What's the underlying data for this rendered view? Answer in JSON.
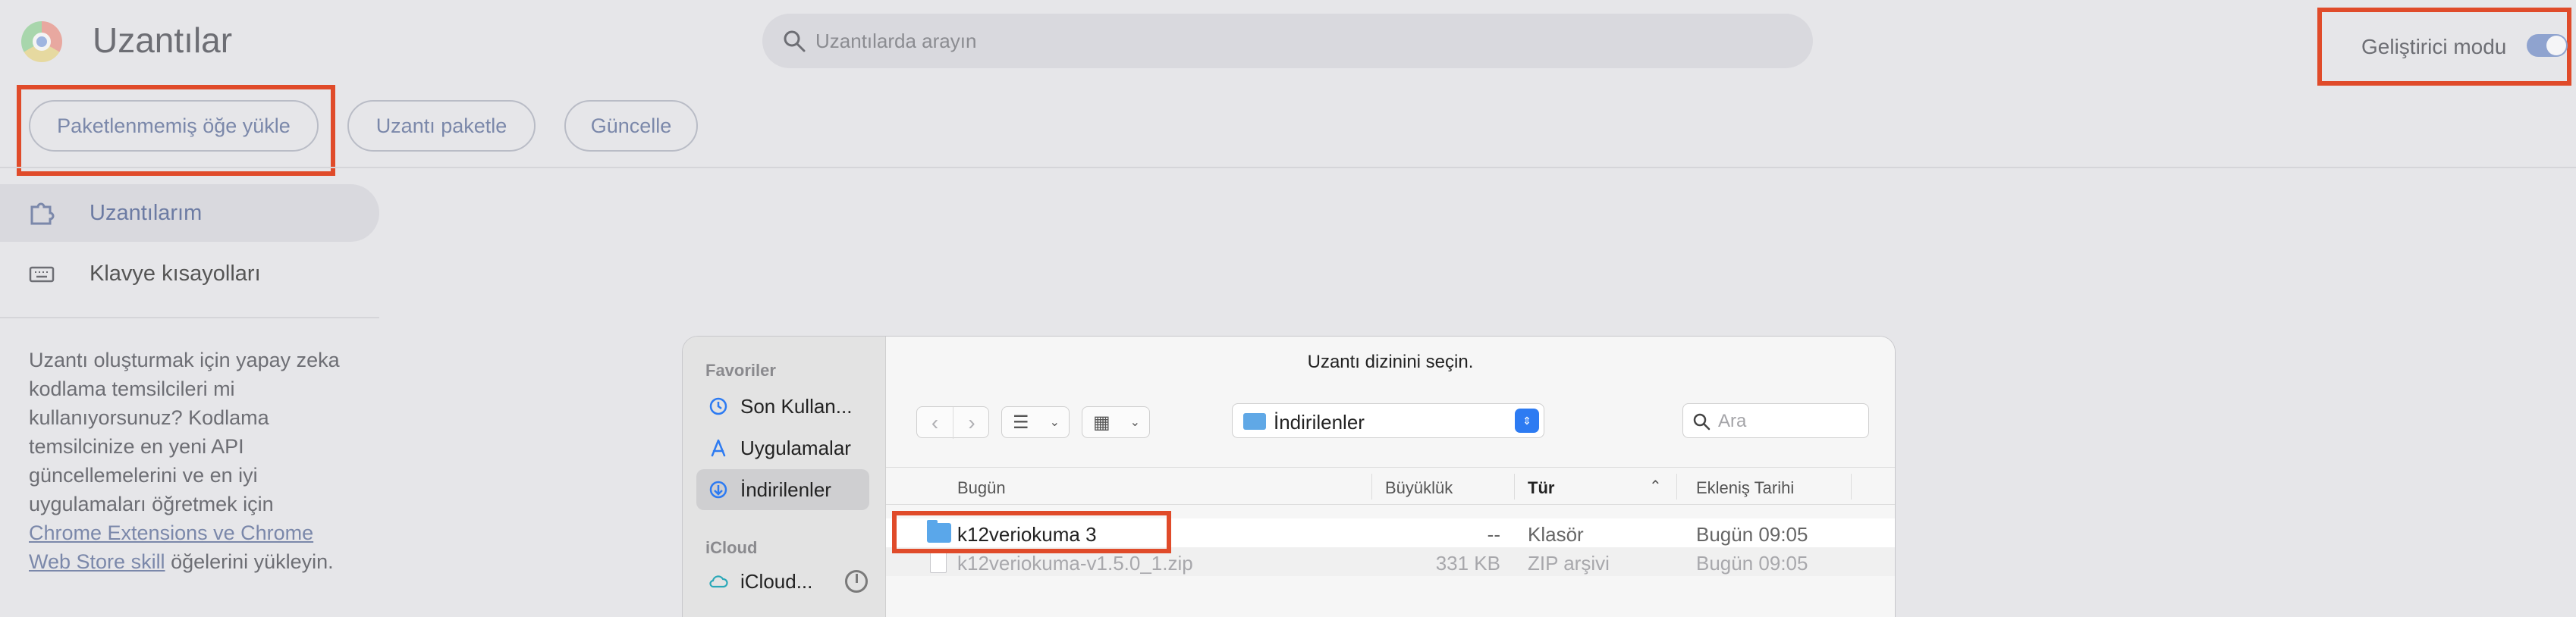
{
  "header": {
    "title": "Uzantılar",
    "search_placeholder": "Uzantılarda arayın",
    "dev_mode_label": "Geliştirici modu",
    "dev_mode_on": true
  },
  "toolbar": {
    "load_unpacked": "Paketlenmemiş öğe yükle",
    "pack_extension": "Uzantı paketle",
    "update": "Güncelle"
  },
  "sidebar": {
    "items": [
      {
        "label": "Uzantılarım",
        "icon": "puzzle-icon",
        "active": true
      },
      {
        "label": "Klavye kısayolları",
        "icon": "keyboard-icon",
        "active": false
      }
    ],
    "promo_text": "Uzantı oluşturmak için yapay zeka kodlama temsilcileri mi kullanıyorsunuz? Kodlama temsilcinize en yeni API güncellemelerini ve en iyi uygulamaları öğretmek için ",
    "promo_link": "Chrome Extensions ve Chrome Web Store skill",
    "promo_suffix": " öğelerini yükleyin."
  },
  "dialog": {
    "title": "Uzantı dizinini seçin.",
    "favorites_label": "Favoriler",
    "favorites": [
      {
        "label": "Son Kullan...",
        "icon": "clock-icon"
      },
      {
        "label": "Uygulamalar",
        "icon": "applications-icon"
      },
      {
        "label": "İndirilenler",
        "icon": "downloads-icon",
        "selected": true
      }
    ],
    "icloud_label": "iCloud",
    "icloud_items": [
      {
        "label": "iCloud...",
        "icon": "cloud-icon"
      }
    ],
    "location": "İndirilenler",
    "search_placeholder": "Ara",
    "columns": {
      "name": "Bugün",
      "size": "Büyüklük",
      "type": "Tür",
      "date": "Ekleniş Tarihi"
    },
    "rows": [
      {
        "name": "k12veriokuma 3",
        "size": "--",
        "type": "Klasör",
        "date": "Bugün 09:05",
        "icon": "folder-icon"
      },
      {
        "name": "k12veriokuma-v1.5.0_1.zip",
        "size": "331 KB",
        "type": "ZIP arşivi",
        "date": "Bugün 09:05",
        "icon": "zip-file-icon"
      }
    ]
  },
  "colors": {
    "highlight": "#e04b2a",
    "accent": "#2d7bf2",
    "folder": "#5aa7ea"
  }
}
